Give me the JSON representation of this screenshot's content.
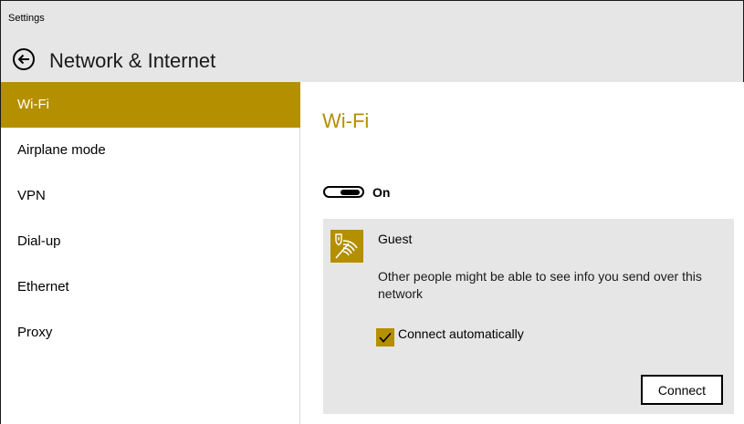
{
  "window": {
    "title": "Settings"
  },
  "header": {
    "title": "Network & Internet",
    "back_icon": "back-arrow-icon"
  },
  "sidebar": {
    "items": [
      {
        "label": "Wi-Fi",
        "selected": true
      },
      {
        "label": "Airplane mode",
        "selected": false
      },
      {
        "label": "VPN",
        "selected": false
      },
      {
        "label": "Dial-up",
        "selected": false
      },
      {
        "label": "Ethernet",
        "selected": false
      },
      {
        "label": "Proxy",
        "selected": false
      }
    ]
  },
  "main": {
    "title": "Wi-Fi",
    "toggle": {
      "state": "On",
      "on": true
    },
    "network": {
      "name": "Guest",
      "icon": "wifi-shield-icon",
      "warning": "Other people might be able to see info you send over this network",
      "auto_connect": {
        "label": "Connect automatically",
        "checked": true
      },
      "connect_label": "Connect"
    }
  },
  "colors": {
    "accent": "#b48f00",
    "chrome": "#e6e6e6",
    "card": "#e6e6e6"
  }
}
